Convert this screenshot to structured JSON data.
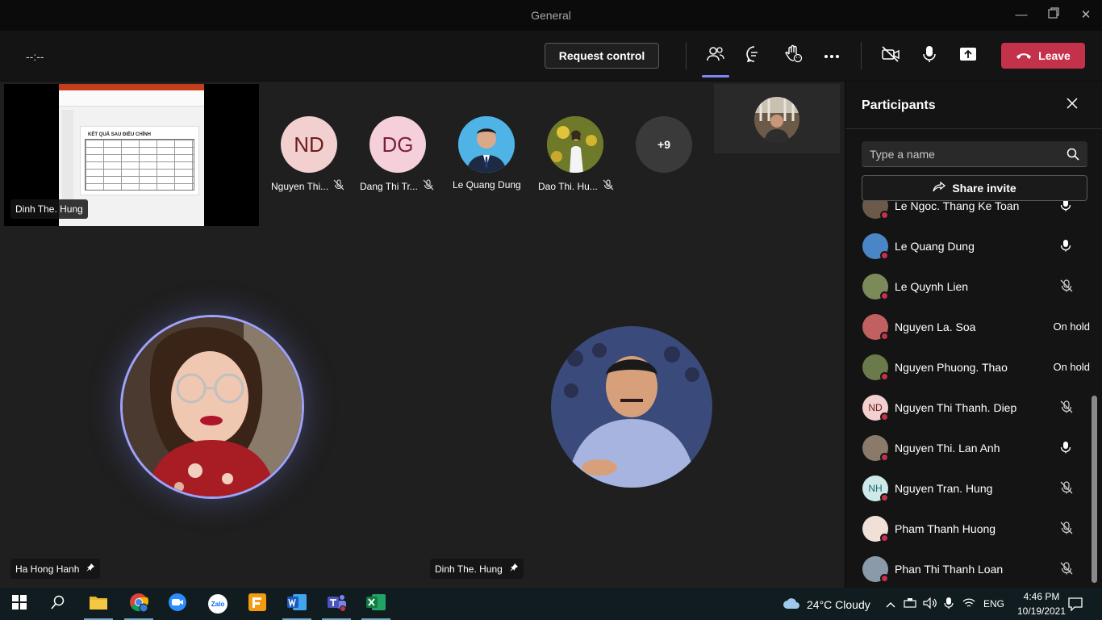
{
  "window": {
    "title": "General"
  },
  "toolbar": {
    "timer": "--:--",
    "request_control_label": "Request control",
    "leave_label": "Leave",
    "icons": [
      "participants-icon",
      "chat-icon",
      "reactions-icon",
      "more-icon",
      "camera-off-icon",
      "mic-icon",
      "share-tray-icon",
      "leave-phone-icon"
    ]
  },
  "stage": {
    "shared_screen": {
      "presenter": "Dinh The. Hung",
      "slide_title": "KẾT QUẢ SAU ĐIỀU CHỈNH"
    },
    "gallery": [
      {
        "initials": "ND",
        "name": "Nguyen Thi...",
        "muted": true,
        "bg": "#f1d0cf",
        "fg": "#6e1d1d"
      },
      {
        "initials": "DG",
        "name": "Dang Thi Tr...",
        "muted": true,
        "bg": "#f5cfd9",
        "fg": "#7a1f3c"
      },
      {
        "initials": "",
        "name": "Le Quang Dung",
        "muted": false,
        "photo": "portrait-man-blue"
      },
      {
        "initials": "",
        "name": "Dao Thi. Hu...",
        "muted": true,
        "photo": "portrait-woman-field"
      },
      {
        "initials": "+9",
        "name": "",
        "muted": false,
        "bg": "#3a3a3a",
        "fg": "#ffffff"
      }
    ],
    "pinned": [
      {
        "name": "Ha Hong Hanh",
        "speaking": true
      },
      {
        "name": "Dinh The. Hung",
        "speaking": false
      }
    ]
  },
  "panel": {
    "title": "Participants",
    "search_placeholder": "Type a name",
    "share_invite_label": "Share invite",
    "participants": [
      {
        "name": "Le Ngoc. Thang Ke Toan",
        "status": "mic-on",
        "initials": "",
        "bg": "#6b5a4a"
      },
      {
        "name": "Le Quang Dung",
        "status": "mic-on",
        "initials": "",
        "bg": "#4a86c5"
      },
      {
        "name": "Le Quynh Lien",
        "status": "muted",
        "initials": "",
        "bg": "#7c8a5a"
      },
      {
        "name": "Nguyen La. Soa",
        "status": "On hold",
        "initials": "",
        "bg": "#c06060"
      },
      {
        "name": "Nguyen Phuong. Thao",
        "status": "On hold",
        "initials": "",
        "bg": "#6b7a4a"
      },
      {
        "name": "Nguyen Thi Thanh. Diep",
        "status": "muted",
        "initials": "ND",
        "bg": "#f1d0cf"
      },
      {
        "name": "Nguyen Thi. Lan Anh",
        "status": "mic-on",
        "initials": "",
        "bg": "#8a7a6a"
      },
      {
        "name": "Nguyen Tran. Hung",
        "status": "muted",
        "initials": "NH",
        "bg": "#cde9ea"
      },
      {
        "name": "Pham Thanh Huong",
        "status": "muted",
        "initials": "",
        "bg": "#f0e0d8"
      },
      {
        "name": "Phan Thi Thanh Loan",
        "status": "muted",
        "initials": "",
        "bg": "#8a9aa8"
      }
    ]
  },
  "taskbar": {
    "apps": [
      "start-icon",
      "search-icon",
      "file-explorer-icon",
      "chrome-icon",
      "zoom-icon",
      "zalo-icon",
      "foxit-pdf-icon",
      "word-icon",
      "teams-icon",
      "excel-icon"
    ],
    "zalo_label": "Zalo",
    "weather": "24°C  Cloudy",
    "language": "ENG",
    "time": "4:46 PM",
    "date": "10/19/2021"
  },
  "colors": {
    "accent": "#7f85f5",
    "leave": "#c4314b",
    "panel_bg": "#141414",
    "stage_bg": "#1f1f1f"
  }
}
